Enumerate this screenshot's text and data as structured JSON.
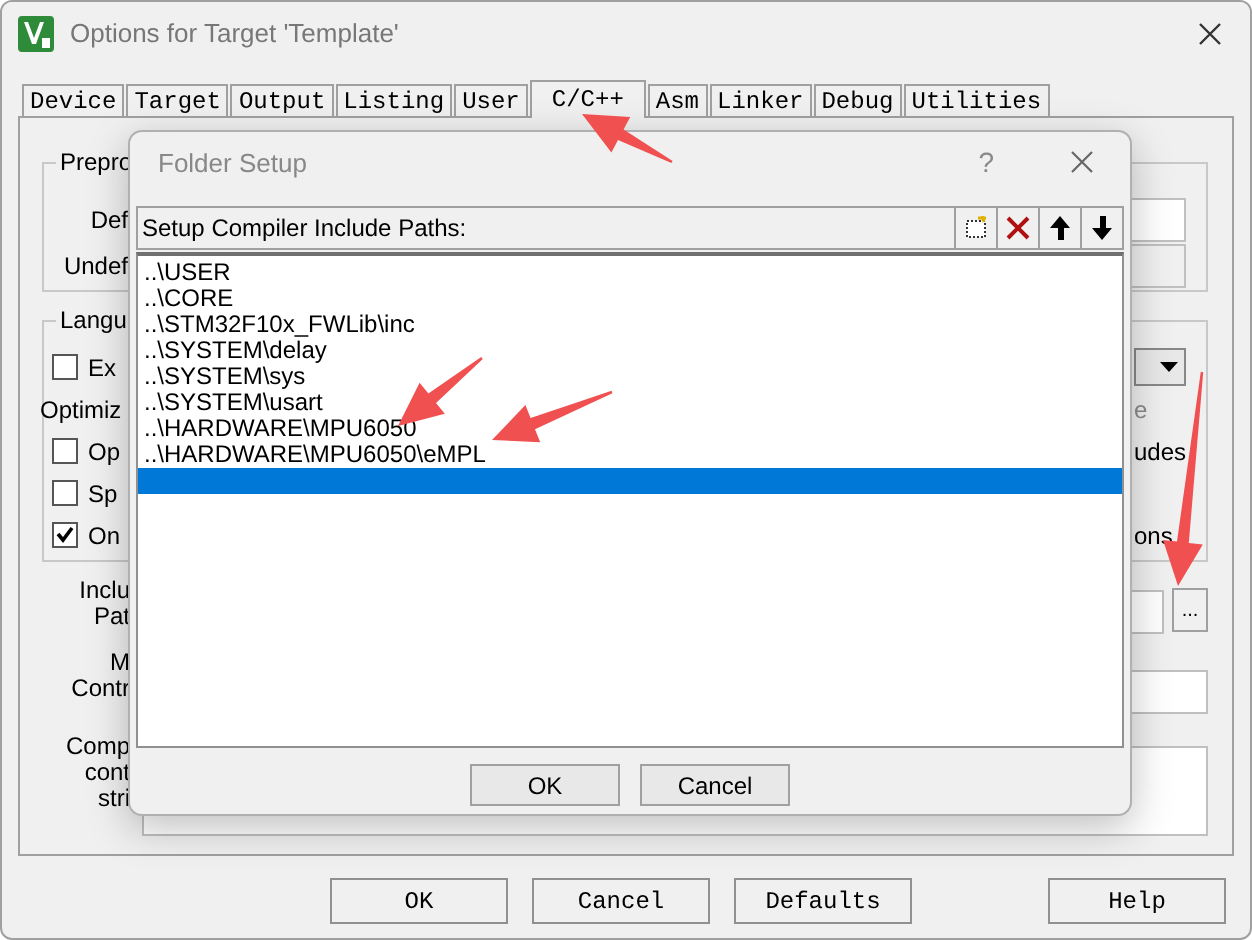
{
  "window": {
    "title": "Options for Target 'Template'"
  },
  "tabs": [
    {
      "label": "Device",
      "selected": false
    },
    {
      "label": "Target",
      "selected": false
    },
    {
      "label": "Output",
      "selected": false
    },
    {
      "label": "Listing",
      "selected": false
    },
    {
      "label": "User",
      "selected": false
    },
    {
      "label": "C/C++",
      "selected": true
    },
    {
      "label": "Asm",
      "selected": false
    },
    {
      "label": "Linker",
      "selected": false
    },
    {
      "label": "Debug",
      "selected": false
    },
    {
      "label": "Utilities",
      "selected": false
    }
  ],
  "preprocessor": {
    "legend": "Prepro",
    "rows": [
      {
        "label": "Def",
        "disabled": false
      },
      {
        "label": "Undef",
        "disabled": true
      }
    ]
  },
  "language": {
    "legend": "Langu",
    "rows": [
      {
        "kind": "checkbox",
        "label": "Ex",
        "checked": false,
        "right": {
          "kind": "dropdown"
        }
      },
      {
        "kind": "text",
        "label": "Optimiz",
        "right": {
          "kind": "text",
          "text": "e",
          "disabled": true
        }
      },
      {
        "kind": "checkbox",
        "label": "Op",
        "checked": false,
        "right": {
          "kind": "text",
          "text": "udes",
          "disabled": false
        }
      },
      {
        "kind": "checkbox",
        "label": "Sp",
        "checked": false
      },
      {
        "kind": "checkbox",
        "label": "On",
        "checked": true,
        "right": {
          "kind": "text",
          "text": "ons",
          "disabled": false
        }
      }
    ]
  },
  "fields": [
    {
      "kind": "path",
      "label_lines": [
        "Inclu",
        "Pat"
      ],
      "browse": "..."
    },
    {
      "kind": "single",
      "label_lines": [
        "M",
        "Contr"
      ]
    },
    {
      "kind": "multi",
      "label_lines": [
        "Comp",
        "cont",
        "stri"
      ]
    }
  ],
  "folder_setup": {
    "title": "Folder Setup",
    "help": "?",
    "list_label": "Setup Compiler Include Paths:",
    "toolbar": [
      {
        "kind": "new"
      },
      {
        "kind": "delete"
      },
      {
        "kind": "up"
      },
      {
        "kind": "down"
      }
    ],
    "paths": [
      {
        "text": "..\\USER",
        "selected": false
      },
      {
        "text": "..\\CORE",
        "selected": false
      },
      {
        "text": "..\\STM32F10x_FWLib\\inc",
        "selected": false
      },
      {
        "text": "..\\SYSTEM\\delay",
        "selected": false
      },
      {
        "text": "..\\SYSTEM\\sys",
        "selected": false
      },
      {
        "text": "..\\SYSTEM\\usart",
        "selected": false
      },
      {
        "text": "..\\HARDWARE\\MPU6050",
        "selected": false
      },
      {
        "text": "..\\HARDWARE\\MPU6050\\eMPL",
        "selected": false
      }
    ],
    "blank_row_selected": true,
    "buttons": [
      "OK",
      "Cancel"
    ]
  },
  "buttons": [
    "OK",
    "Cancel",
    "Defaults",
    "Help"
  ]
}
